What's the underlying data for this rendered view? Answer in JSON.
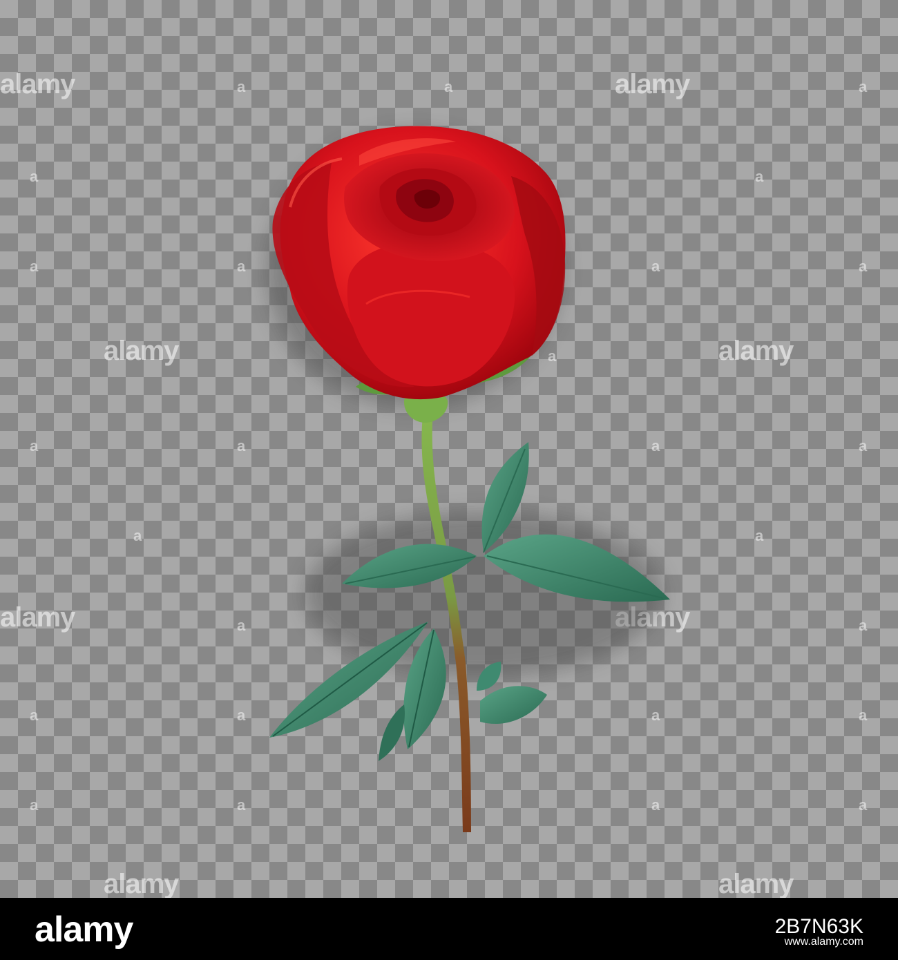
{
  "watermark": {
    "text": "alamy",
    "mark": "a"
  },
  "footer": {
    "brand": "alamy",
    "image_code": "2B7N63K",
    "url": "www.alamy.com"
  },
  "colors": {
    "petal": "#c8101a",
    "petal_dark": "#7a0008",
    "leaf": "#3f8a70",
    "leaf_dark": "#1f5a45",
    "stem_green": "#7fae4a",
    "stem_brown": "#8a4a22"
  }
}
